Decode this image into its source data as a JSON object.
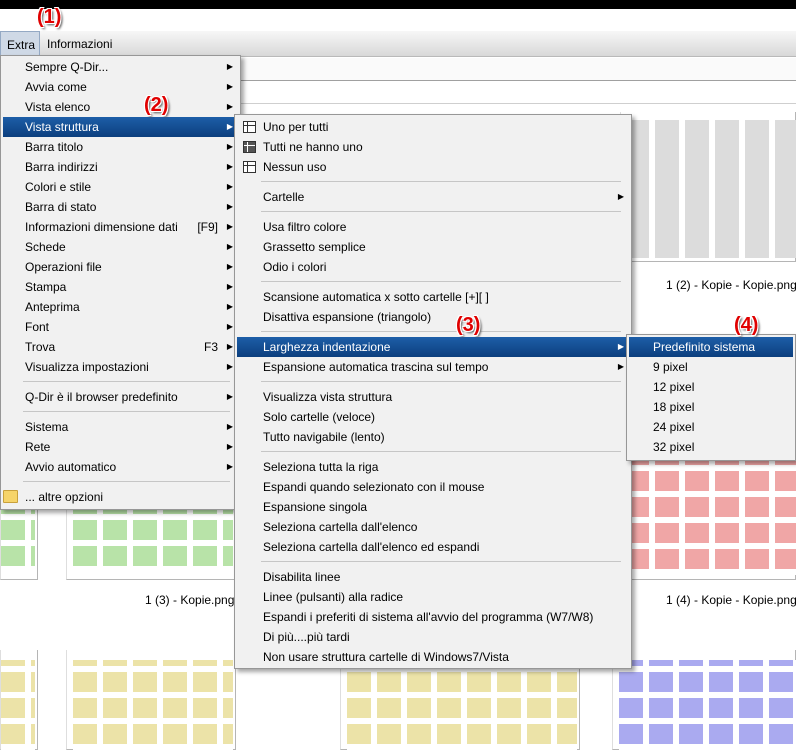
{
  "menubar": {
    "extra": "Extra",
    "info": "Informazioni"
  },
  "annotations": {
    "a1": "(1)",
    "a2": "(2)",
    "a3": "(3)",
    "a4": "(4)"
  },
  "captions": {
    "c1": "1 (2) - Kopie - Kopie.png",
    "c2": "1 (3) - Kopie.png",
    "c3": "1 (4) - Kopie - Kopie.png"
  },
  "extra_menu": [
    {
      "label": "Sempre Q-Dir...",
      "arrow": true
    },
    {
      "label": "Avvia come",
      "arrow": true
    },
    {
      "label": "Vista elenco",
      "arrow": true
    },
    {
      "label": "Vista struttura",
      "arrow": true,
      "highlight": true
    },
    {
      "label": "Barra titolo",
      "arrow": true
    },
    {
      "label": "Barra indirizzi",
      "arrow": true
    },
    {
      "label": "Colori e stile",
      "arrow": true
    },
    {
      "label": "Barra di stato",
      "arrow": true
    },
    {
      "label": "Informazioni dimensione dati",
      "shortcut": "[F9]",
      "arrow": true
    },
    {
      "label": "Schede",
      "arrow": true
    },
    {
      "label": "Operazioni file",
      "arrow": true
    },
    {
      "label": "Stampa",
      "arrow": true
    },
    {
      "label": "Anteprima",
      "arrow": true
    },
    {
      "label": "Font",
      "arrow": true
    },
    {
      "label": "Trova",
      "shortcut": "F3",
      "arrow": true
    },
    {
      "label": "Visualizza impostazioni",
      "arrow": true
    },
    {
      "separator": true
    },
    {
      "label": "Q-Dir è il browser predefinito",
      "arrow": true
    },
    {
      "separator": true
    },
    {
      "label": "Sistema",
      "arrow": true
    },
    {
      "label": "Rete",
      "arrow": true
    },
    {
      "label": "Avvio automatico",
      "arrow": true
    },
    {
      "separator": true
    },
    {
      "label": "... altre opzioni",
      "icon": "folder-icon"
    }
  ],
  "tree_menu": [
    {
      "label": "Uno per tutti",
      "icon": "grid-icon"
    },
    {
      "label": "Tutti ne hanno uno",
      "icon": "grid-dark-icon"
    },
    {
      "label": "Nessun uso",
      "icon": "grid-icon"
    },
    {
      "separator": true
    },
    {
      "label": "Cartelle",
      "arrow": true
    },
    {
      "separator": true
    },
    {
      "label": "Usa filtro colore"
    },
    {
      "label": "Grassetto semplice"
    },
    {
      "label": "Odio i colori"
    },
    {
      "separator": true
    },
    {
      "label": "Scansione automatica x sotto cartelle [+][ ]"
    },
    {
      "label": "Disattiva espansione (triangolo)"
    },
    {
      "separator": true
    },
    {
      "label": "Larghezza indentazione",
      "arrow": true,
      "highlight": true
    },
    {
      "label": "Espansione automatica trascina sul tempo",
      "arrow": true
    },
    {
      "separator": true
    },
    {
      "label": "Visualizza vista struttura"
    },
    {
      "label": "Solo cartelle (veloce)"
    },
    {
      "label": "Tutto navigabile (lento)"
    },
    {
      "separator": true
    },
    {
      "label": "Seleziona tutta la riga"
    },
    {
      "label": "Espandi quando selezionato con il mouse"
    },
    {
      "label": "Espansione singola"
    },
    {
      "label": "Seleziona cartella dall'elenco"
    },
    {
      "label": "Seleziona cartella dall'elenco ed espandi"
    },
    {
      "separator": true
    },
    {
      "label": "Disabilita linee"
    },
    {
      "label": "Linee (pulsanti) alla radice"
    },
    {
      "label": "Espandi i preferiti di sistema all'avvio del programma (W7/W8)"
    },
    {
      "label": "Di più....più tardi"
    },
    {
      "label": "Non usare struttura cartelle di Windows7/Vista"
    }
  ],
  "indent_menu": [
    {
      "label": "Predefinito sistema",
      "highlight": true
    },
    {
      "label": "9 pixel"
    },
    {
      "label": "12 pixel"
    },
    {
      "label": "18 pixel"
    },
    {
      "label": "24 pixel"
    },
    {
      "label": "32 pixel"
    }
  ],
  "colors": {
    "highlight": "#0c3f7e",
    "anno": "#e00000",
    "thumb_grey": "#c9c9c9",
    "thumb_red": "#f0a6a6",
    "thumb_green": "#b8e3a8",
    "thumb_yellow": "#ece3a8",
    "thumb_blue": "#aaaaf0"
  }
}
